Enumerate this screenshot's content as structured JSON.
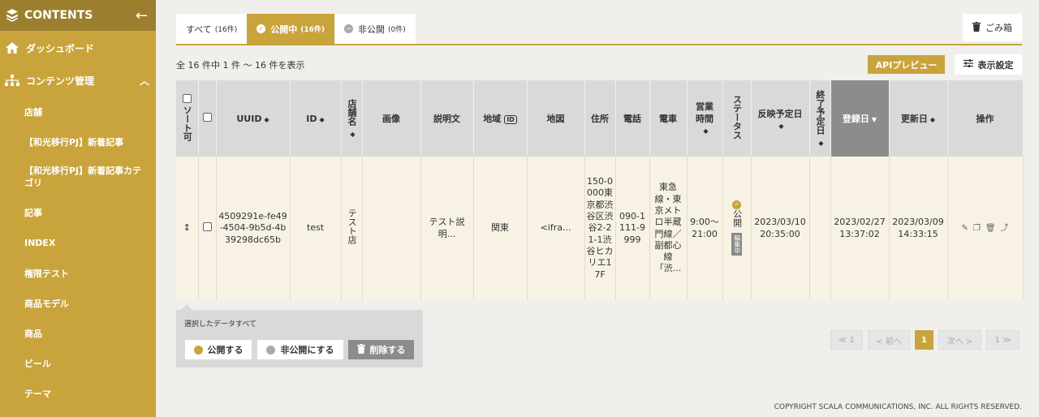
{
  "sidebar": {
    "title": "CONTENTS",
    "dashboard": "ダッシュボード",
    "content_mgmt": "コンテンツ管理",
    "items": [
      "店舗",
      "【和光移行PJ】新着記事",
      "【和光移行PJ】新着記事カテゴリ",
      "記事",
      "INDEX",
      "権限テスト",
      "商品モデル",
      "商品",
      "ビール",
      "テーマ"
    ]
  },
  "tabs": [
    {
      "label": "すべて",
      "count": "(16件)"
    },
    {
      "label": "公開中",
      "count": "(16件)"
    },
    {
      "label": "非公開",
      "count": "(0件)"
    }
  ],
  "trash_label": "ごみ箱",
  "summary": "全 16 件中 1 件 〜 16 件を表示",
  "api_preview": "APIプレビュー",
  "display_settings": "表示設定",
  "table": {
    "headers": {
      "sort": "ソート可",
      "uuid": "UUID",
      "id": "ID",
      "store_name": "店舗名",
      "image": "画像",
      "description": "説明文",
      "region": "地域",
      "map": "地図",
      "address": "住所",
      "phone": "電話",
      "train": "電車",
      "hours": "営業時間",
      "status": "ステータス",
      "scheduled": "反映予定日",
      "end_scheduled": "終了予定日",
      "registered": "登録日",
      "updated": "更新日",
      "actions": "操作"
    },
    "row": {
      "uuid": "4509291e-fe49-4504-9b5d-4b39298dc65b",
      "id": "test",
      "store_name": "テスト店",
      "description": "テスト説明...",
      "region": "関東",
      "map": "<ifra...",
      "address": "150-0000東京都渋谷区渋谷2-21-1渋谷ヒカリエ17F",
      "phone": "090-1111-9999",
      "train": "東急線・東京メトロ半蔵門線／副都心線「渋...",
      "hours": "9:00〜21:00",
      "status": "公開",
      "editing": "編集中",
      "scheduled": "2023/03/10 20:35:00",
      "registered": "2023/02/27 13:37:02",
      "updated": "2023/03/09 14:33:15"
    }
  },
  "bulk": {
    "label": "選択したデータすべて",
    "publish": "公開する",
    "unpublish": "非公開にする",
    "delete": "削除する"
  },
  "pagination": {
    "first": "≪ 1",
    "prev": "< 前へ",
    "current": "1",
    "next": "次へ >",
    "last": "1 ≫"
  },
  "copyright": "COPYRIGHT SCALA COMMUNICATIONS, INC. ALL RIGHTS RESERVED.",
  "colors": {
    "accent": "#c9a43c",
    "accent_dark": "#9b7f2f"
  }
}
